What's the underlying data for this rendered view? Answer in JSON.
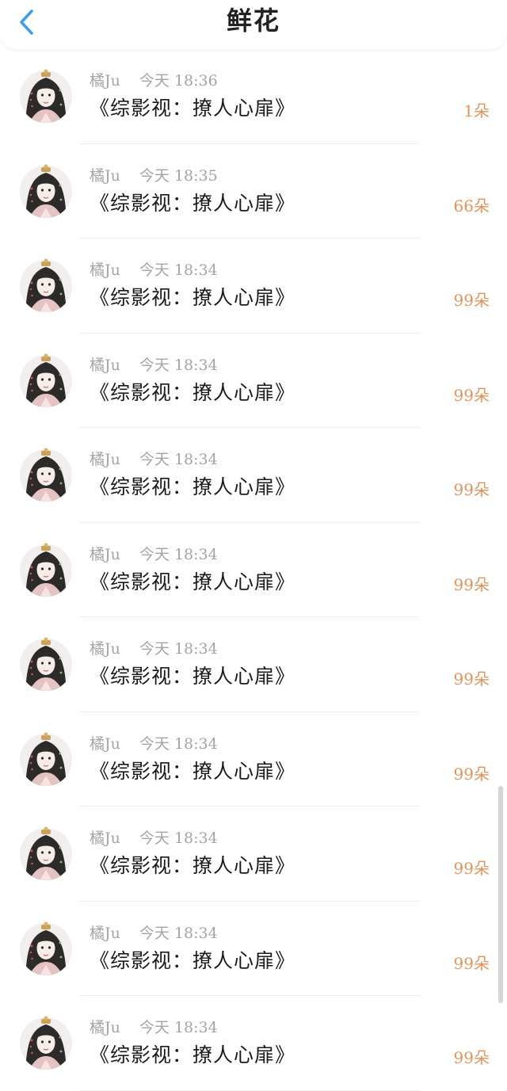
{
  "header": {
    "title": "鲜花",
    "back_icon": "chevron-left-icon",
    "accent_color": "#3b9df0"
  },
  "records": [
    {
      "user": "橘Ju",
      "time": "今天 18:36",
      "book": "《综影视：撩人心扉》",
      "count": "1朵"
    },
    {
      "user": "橘Ju",
      "time": "今天 18:35",
      "book": "《综影视：撩人心扉》",
      "count": "66朵"
    },
    {
      "user": "橘Ju",
      "time": "今天 18:34",
      "book": "《综影视：撩人心扉》",
      "count": "99朵"
    },
    {
      "user": "橘Ju",
      "time": "今天 18:34",
      "book": "《综影视：撩人心扉》",
      "count": "99朵"
    },
    {
      "user": "橘Ju",
      "time": "今天 18:34",
      "book": "《综影视：撩人心扉》",
      "count": "99朵"
    },
    {
      "user": "橘Ju",
      "time": "今天 18:34",
      "book": "《综影视：撩人心扉》",
      "count": "99朵"
    },
    {
      "user": "橘Ju",
      "time": "今天 18:34",
      "book": "《综影视：撩人心扉》",
      "count": "99朵"
    },
    {
      "user": "橘Ju",
      "time": "今天 18:34",
      "book": "《综影视：撩人心扉》",
      "count": "99朵"
    },
    {
      "user": "橘Ju",
      "time": "今天 18:34",
      "book": "《综影视：撩人心扉》",
      "count": "99朵"
    },
    {
      "user": "橘Ju",
      "time": "今天 18:34",
      "book": "《综影视：撩人心扉》",
      "count": "99朵"
    },
    {
      "user": "橘Ju",
      "time": "今天 18:34",
      "book": "《综影视：撩人心扉》",
      "count": "99朵"
    }
  ],
  "colors": {
    "count": "#e2935a",
    "meta": "#a4a4a4",
    "book": "#1a1a1a"
  }
}
